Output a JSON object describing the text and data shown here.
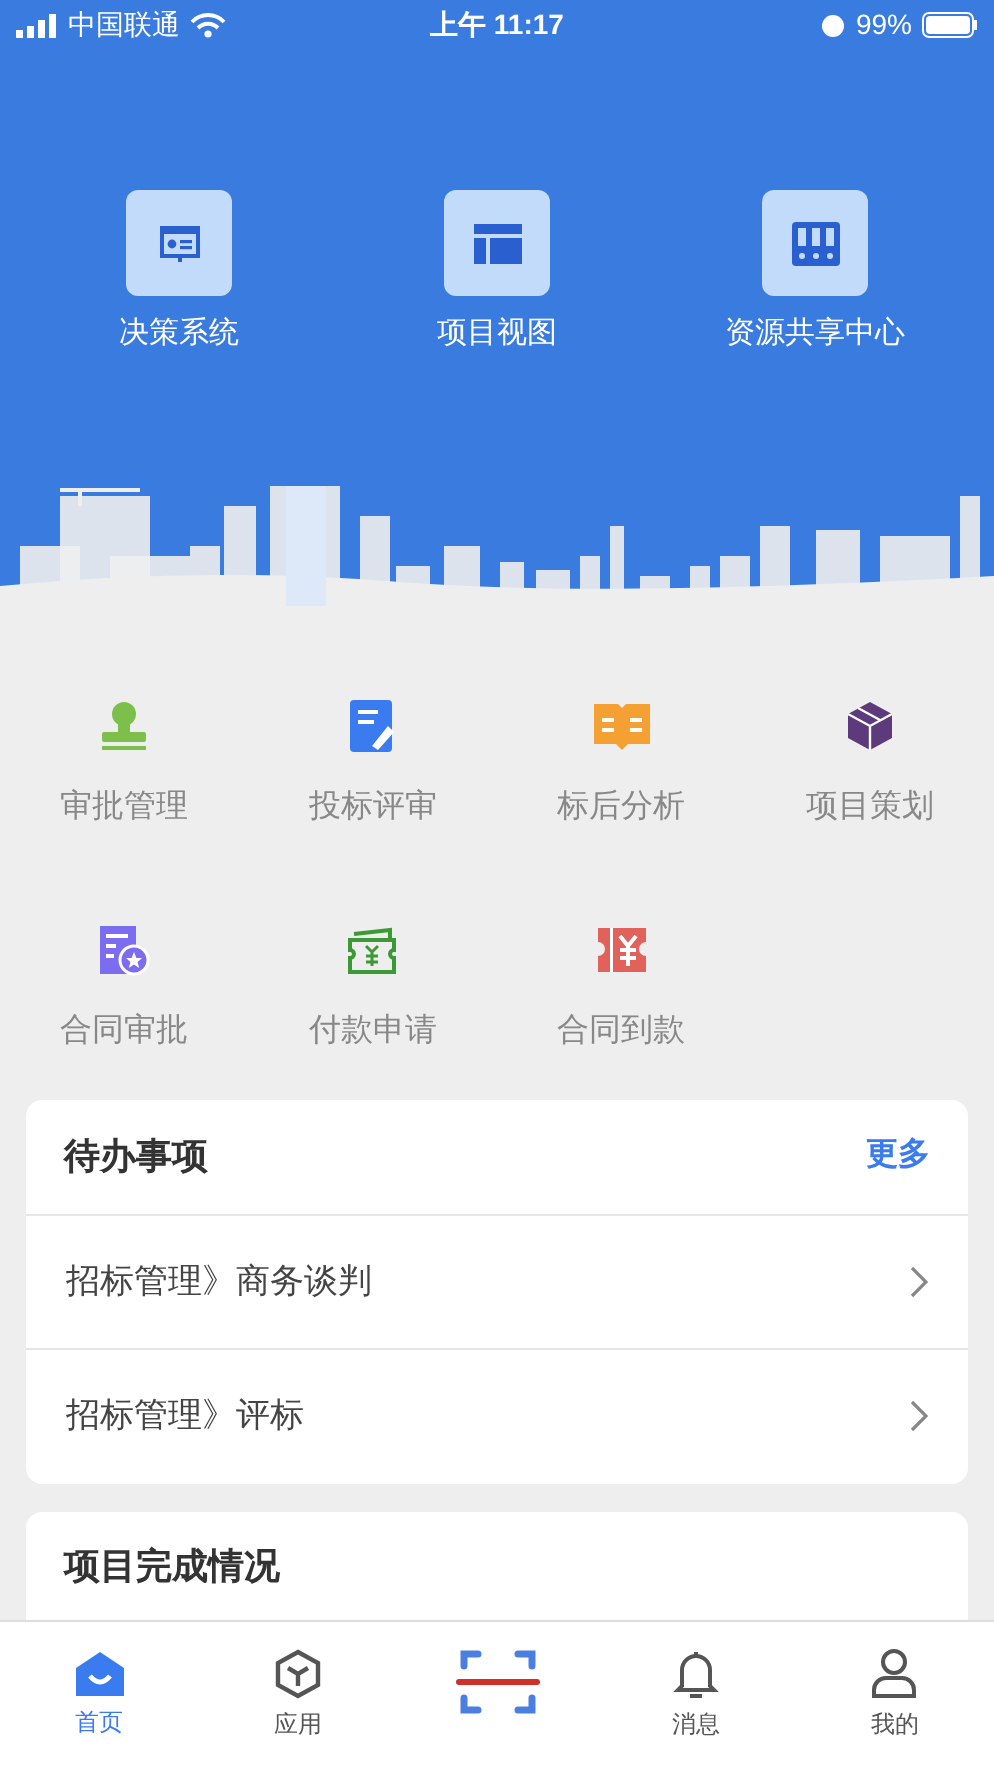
{
  "status_bar": {
    "carrier": "中国联通",
    "time": "上午 11:17",
    "battery": "99%"
  },
  "header_shortcuts": [
    {
      "label": "决策系统"
    },
    {
      "label": "项目视图"
    },
    {
      "label": "资源共享中心"
    }
  ],
  "apps": [
    {
      "label": "审批管理"
    },
    {
      "label": "投标评审"
    },
    {
      "label": "标后分析"
    },
    {
      "label": "项目策划"
    },
    {
      "label": "合同审批"
    },
    {
      "label": "付款申请"
    },
    {
      "label": "合同到款"
    }
  ],
  "todo": {
    "title": "待办事项",
    "more": "更多",
    "items": [
      {
        "label": "招标管理》商务谈判"
      },
      {
        "label": "招标管理》评标"
      }
    ]
  },
  "progress_card": {
    "title": "项目完成情况"
  },
  "tab_bar": [
    {
      "kind": "tab",
      "label": "首页",
      "selected": true
    },
    {
      "kind": "tab",
      "label": "应用",
      "selected": false
    },
    {
      "kind": "scan"
    },
    {
      "kind": "tab",
      "label": "消息",
      "selected": false
    },
    {
      "kind": "tab",
      "label": "我的",
      "selected": false
    }
  ]
}
